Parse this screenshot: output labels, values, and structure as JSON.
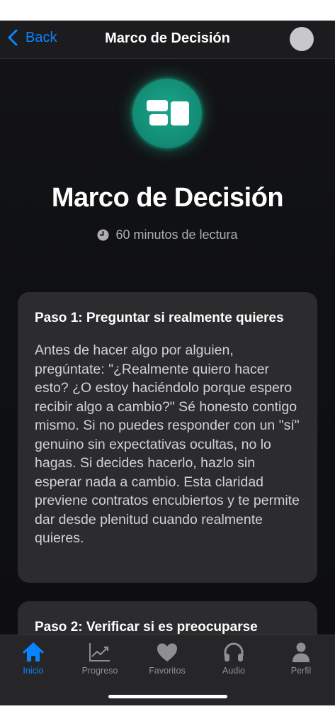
{
  "nav": {
    "back_label": "Back",
    "title": "Marco de Decisión"
  },
  "header": {
    "title": "Marco de Decisión",
    "reading_time": "60 minutos de lectura"
  },
  "steps": [
    {
      "title": "Paso 1: Preguntar si realmente quieres",
      "body": "Antes de hacer algo por alguien, pregúntate: \"¿Realmente quiero hacer esto? ¿O estoy haciéndolo porque espero recibir algo a cambio?\" Sé honesto contigo mismo. Si no puedes responder con un \"sí\" genuino sin expectativas ocultas, no lo hagas. Si decides hacerlo, hazlo sin esperar nada a cambio. Esta claridad previene contratos encubiertos y te permite dar desde plenitud cuando realmente quieres."
    },
    {
      "title": "Paso 2: Verificar si es preocuparse"
    }
  ],
  "tabs": [
    {
      "label": "Inicio",
      "icon": "home-icon",
      "active": true
    },
    {
      "label": "Progreso",
      "icon": "chart-icon"
    },
    {
      "label": "Favoritos",
      "icon": "heart-icon"
    },
    {
      "label": "Audio",
      "icon": "headphones-icon"
    },
    {
      "label": "Perfil",
      "icon": "person-icon"
    }
  ],
  "colors": {
    "accent": "#0a84ff",
    "teal": "#128a73",
    "card": "#2c2c2e",
    "background": "#0f1013"
  }
}
